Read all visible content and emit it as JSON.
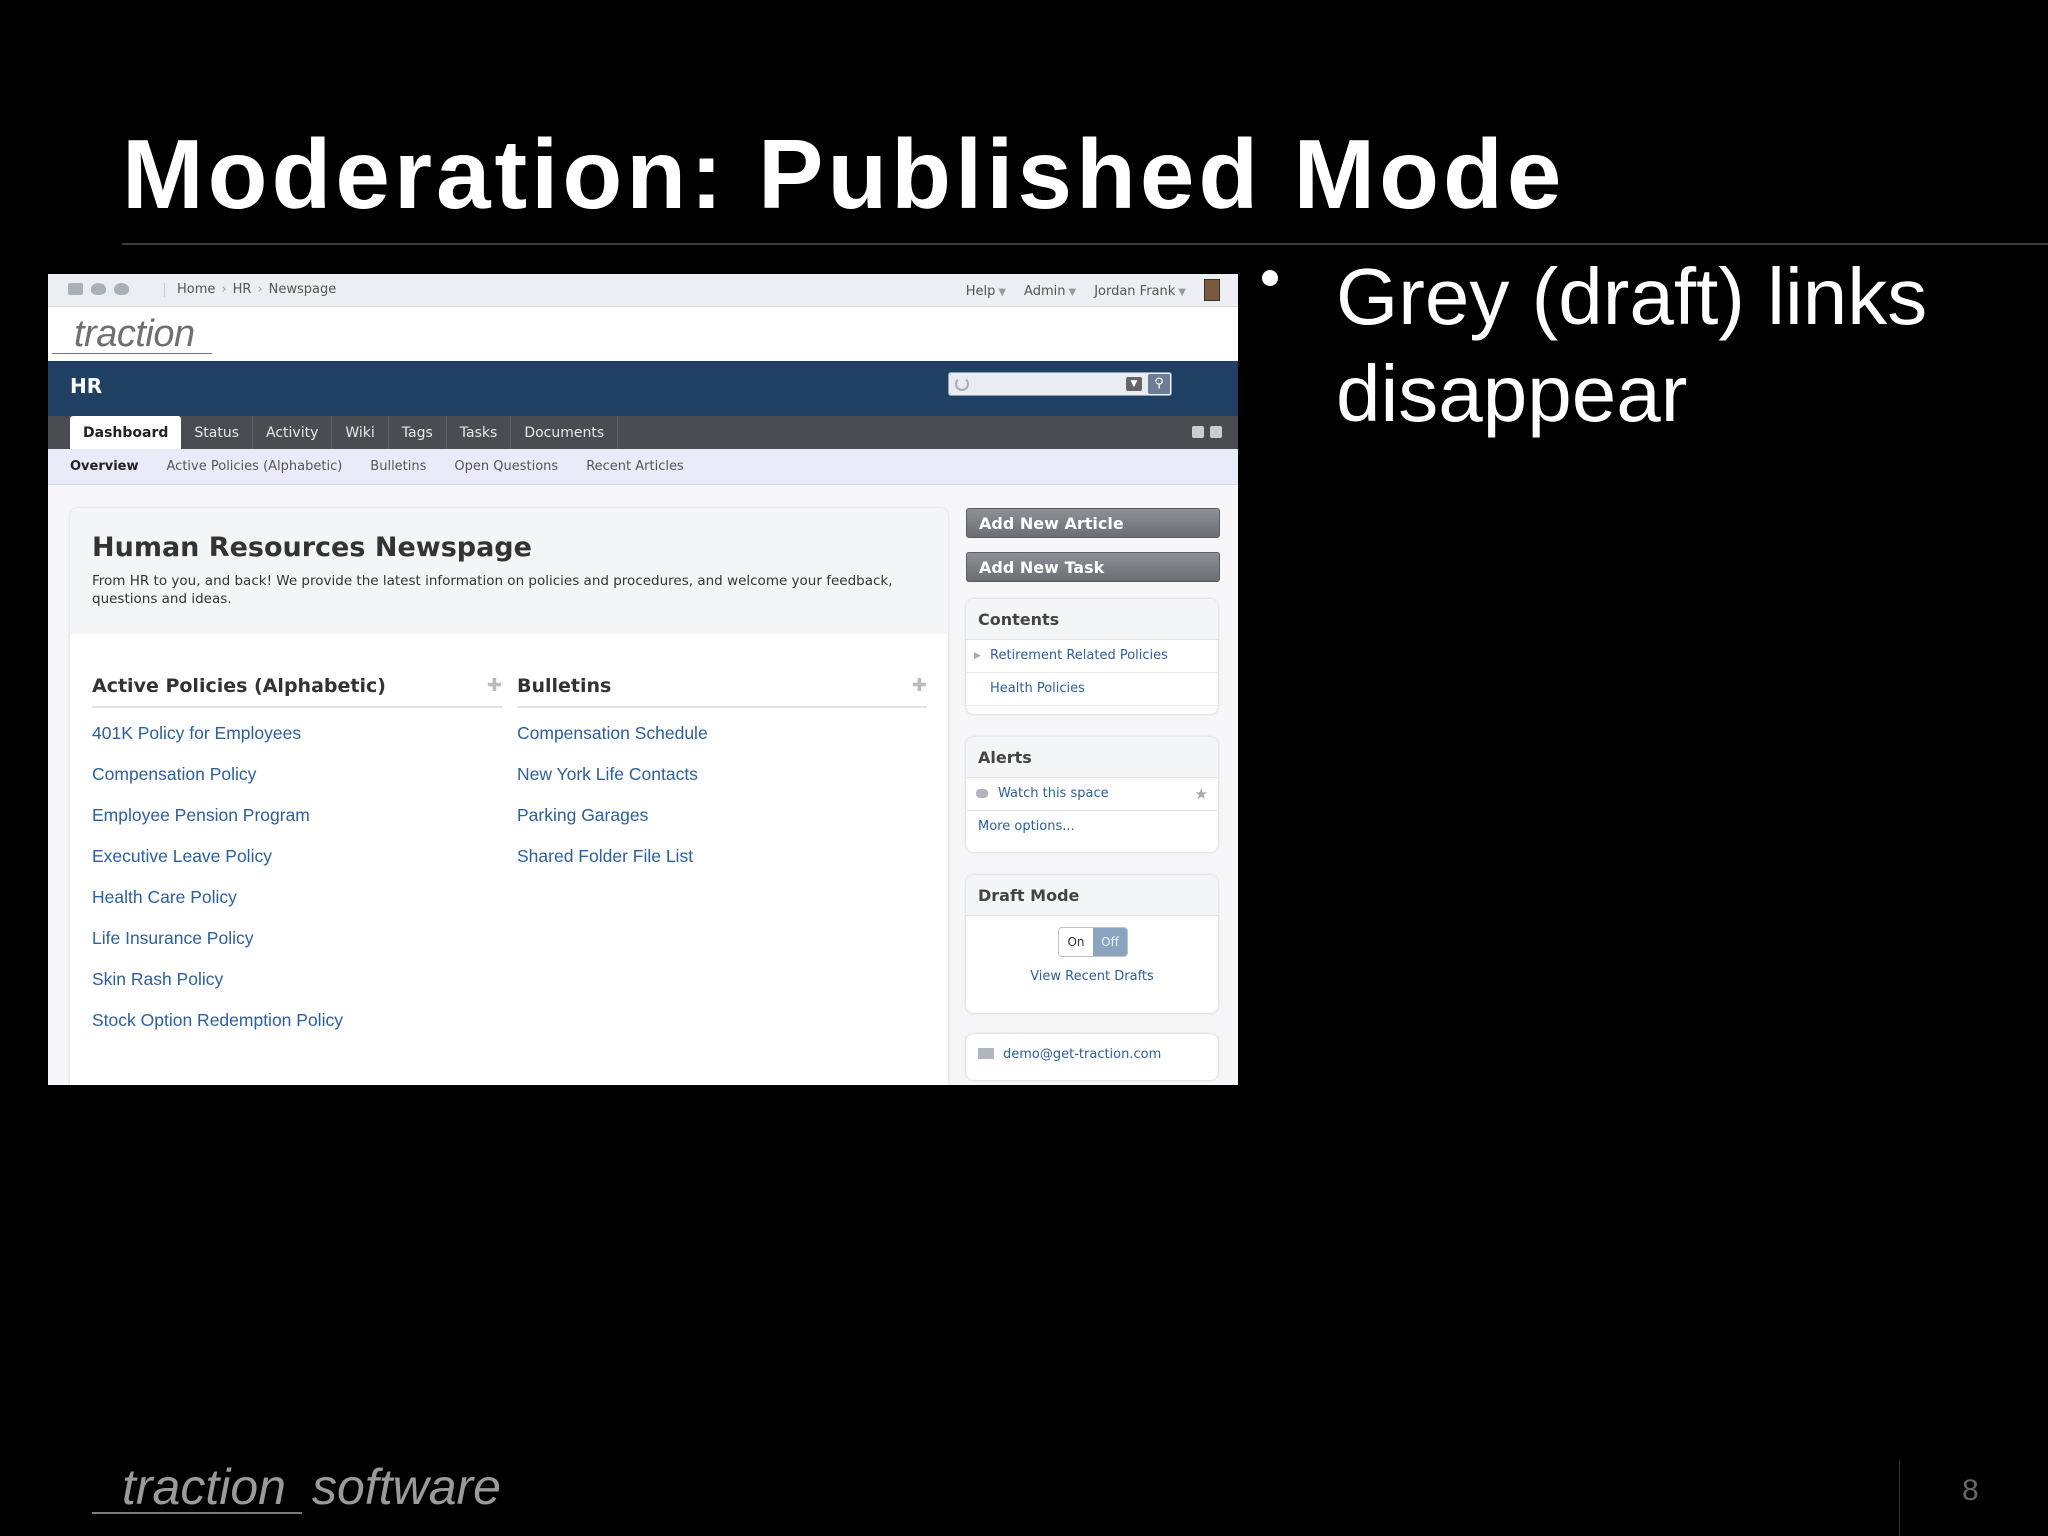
{
  "slide": {
    "title": "Moderation: Published Mode",
    "bullet": "Grey (draft) links disappear",
    "footer_brand": "traction",
    "footer_brand_suffix": "software",
    "page_number": "8"
  },
  "app": {
    "topbar": {
      "breadcrumbs": [
        "Home",
        "HR",
        "Newspage"
      ],
      "help": "Help",
      "admin": "Admin",
      "user": "Jordan Frank"
    },
    "brand": "traction",
    "space_name": "HR",
    "tabs": [
      "Dashboard",
      "Status",
      "Activity",
      "Wiki",
      "Tags",
      "Tasks",
      "Documents"
    ],
    "subnav": [
      "Overview",
      "Active Policies (Alphabetic)",
      "Bulletins",
      "Open Questions",
      "Recent Articles"
    ],
    "main": {
      "title": "Human Resources Newspage",
      "description": "From HR to you, and back! We provide the latest information on policies and procedures, and welcome your feedback, questions and ideas.",
      "policies": {
        "heading": "Active Policies (Alphabetic)",
        "items": [
          "401K Policy for Employees",
          "Compensation Policy",
          "Employee Pension Program",
          "Executive Leave Policy",
          "Health Care Policy",
          "Life Insurance Policy",
          "Skin Rash Policy",
          "Stock Option Redemption Policy"
        ]
      },
      "bulletins": {
        "heading": "Bulletins",
        "items": [
          "Compensation Schedule",
          "New York Life Contacts",
          "Parking Garages",
          "Shared Folder File List"
        ]
      }
    },
    "sidebar": {
      "add_article": "Add New Article",
      "add_task": "Add New Task",
      "contents": {
        "heading": "Contents",
        "items": [
          "Retirement Related Policies",
          "Health Policies"
        ]
      },
      "alerts": {
        "heading": "Alerts",
        "watch": "Watch this space",
        "more": "More options..."
      },
      "draft_mode": {
        "heading": "Draft Mode",
        "on_label": "On",
        "off_label": "Off",
        "view_drafts": "View Recent Drafts"
      },
      "email": "demo@get-traction.com"
    }
  }
}
